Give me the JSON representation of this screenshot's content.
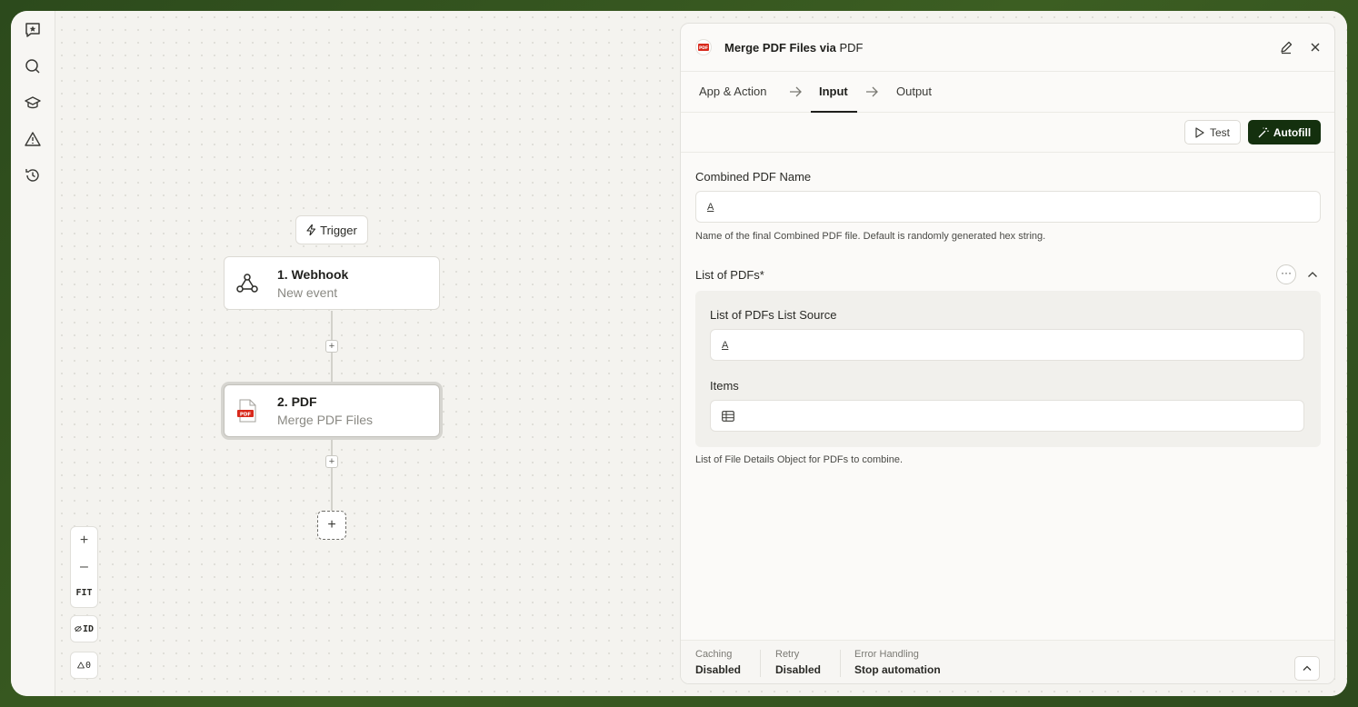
{
  "sidebar": {
    "icons": [
      "star-chat-icon",
      "search-icon",
      "graduation-cap-icon",
      "warning-icon",
      "history-icon"
    ]
  },
  "canvas": {
    "trigger_label": "Trigger",
    "nodes": [
      {
        "title": "1. Webhook",
        "subtitle": "New event",
        "icon": "webhook-icon"
      },
      {
        "title": "2. PDF",
        "subtitle": "Merge PDF Files",
        "icon": "pdf-icon"
      }
    ],
    "add_step": "+",
    "zoom": {
      "in": "+",
      "out": "–",
      "fit": "FIT"
    },
    "id_toggle": "ID",
    "warnings_count": "0"
  },
  "panel": {
    "title_prefix": "Merge PDF Files via ",
    "title_app": "PDF",
    "pdf_badge": "PDF",
    "tabs": [
      "App & Action",
      "Input",
      "Output"
    ],
    "active_tab": "Input",
    "test_label": "Test",
    "autofill_label": "Autofill",
    "fields": {
      "combined_name": {
        "label": "Combined PDF Name",
        "type_glyph": "A",
        "help": "Name of the final Combined PDF file. Default is randomly generated hex string."
      },
      "list_of_pdfs": {
        "label": "List of PDFs*",
        "more": "···",
        "source_label": "List of PDFs List Source",
        "source_glyph": "A",
        "items_label": "Items",
        "help": "List of File Details Object for PDFs to combine."
      }
    },
    "footer": {
      "caching": {
        "label": "Caching",
        "value": "Disabled"
      },
      "retry": {
        "label": "Retry",
        "value": "Disabled"
      },
      "error": {
        "label": "Error Handling",
        "value": "Stop automation"
      }
    }
  },
  "colors": {
    "accent": "#14300e",
    "background": "#f4f3ef",
    "frame": "#2c4a1c"
  }
}
